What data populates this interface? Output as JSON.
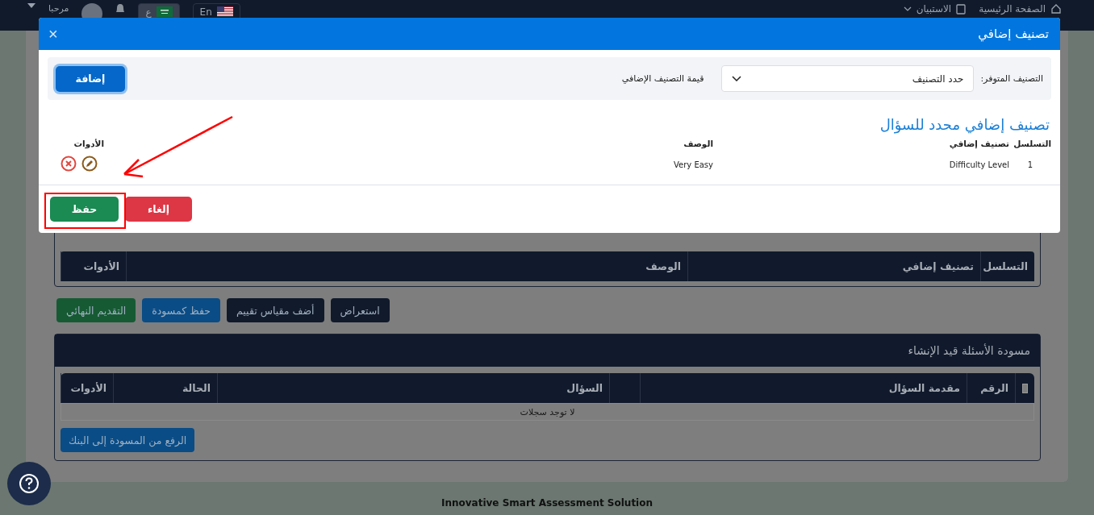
{
  "nav": {
    "home": "الصفحة الرئيسية",
    "survey": "الاستبيان",
    "greeting": "مرحبا",
    "languages": [
      {
        "label": "En",
        "kind": "us",
        "selected": false
      },
      {
        "label": "ع",
        "kind": "sa",
        "selected": true
      }
    ]
  },
  "modal": {
    "title": "تصنيف إضافي",
    "close": "×",
    "filter": {
      "available_label": "التصنيف المتوفر:",
      "select_value": "حدد التصنيف",
      "value_label": "قيمة التصنيف الإضافي",
      "add_button": "إضافة"
    },
    "section_title": "تصنيف إضافي محدد للسؤال",
    "columns": [
      "التسلسل",
      "تصنيف إضافي",
      "الوصف",
      "الأدوات"
    ],
    "rows": [
      {
        "index": "1",
        "classification": "Difficulty Level",
        "description": "Very Easy"
      }
    ],
    "buttons": [
      {
        "label": "إلغاء",
        "kind": "cancel"
      },
      {
        "label": "حفظ",
        "kind": "save"
      }
    ]
  },
  "background": {
    "classification_columns": [
      "التسلسل",
      "تصنيف إضافي",
      "الوصف",
      "الأدوات"
    ],
    "actions": [
      {
        "label": "استعراض",
        "kind": "dark"
      },
      {
        "label": "أضف مقياس تقييم",
        "kind": "dark"
      },
      {
        "label": "حفظ كمسودة",
        "kind": "primary"
      },
      {
        "label": "التقديم النهائي",
        "kind": "success"
      }
    ],
    "draft": {
      "title": "مسودة الأسئلة قيد الإنشاء",
      "select_all": {
        "checked": false
      },
      "columns": [
        "الرقم",
        "مقدمة السؤال",
        "",
        "السؤال",
        "الحالة",
        "الأدوات"
      ],
      "empty": "لا توجد سجلات",
      "upload_button": "الرفع من المسودة إلى البنك"
    }
  },
  "footer": "Innovative Smart Assessment Solution"
}
